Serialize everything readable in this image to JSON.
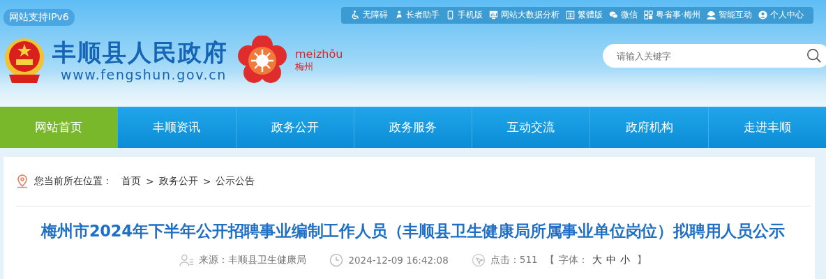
{
  "ipv6_badge": "网站支持IPv6",
  "toolbar": [
    {
      "kind": "wheelchair",
      "label": "无障碍"
    },
    {
      "kind": "elder",
      "label": "长者助手"
    },
    {
      "kind": "phone",
      "label": "手机版"
    },
    {
      "kind": "chart",
      "label": "网站大数据分析"
    },
    {
      "kind": "traditional",
      "label": "繁體版"
    },
    {
      "kind": "wechat",
      "label": "微信"
    },
    {
      "kind": "grid",
      "label": "粤省事·梅州"
    },
    {
      "kind": "service",
      "label": "智能互动"
    },
    {
      "kind": "user",
      "label": "个人中心"
    }
  ],
  "site": {
    "title": "丰顺县人民政府",
    "url": "www.fengshun.gov.cn",
    "city_logo": {
      "pinyin": "meizhōu",
      "name": "梅州"
    }
  },
  "search": {
    "placeholder": "请输入关键字"
  },
  "nav": [
    {
      "label": "网站首页",
      "selected": true
    },
    {
      "label": "丰顺资讯",
      "selected": false
    },
    {
      "label": "政务公开",
      "selected": false
    },
    {
      "label": "政务服务",
      "selected": false
    },
    {
      "label": "互动交流",
      "selected": false
    },
    {
      "label": "政府机构",
      "selected": false
    },
    {
      "label": "走进丰顺",
      "selected": false
    }
  ],
  "breadcrumb": {
    "label": "您当前所在位置：",
    "items": [
      "首页",
      "政务公开",
      "公示公告"
    ],
    "separator": ">"
  },
  "article": {
    "title": "梅州市2024年下半年公开招聘事业编制工作人员（丰顺县卫生健康局所属事业单位岗位）拟聘用人员公示",
    "source": "来源：丰顺县卫生健康局",
    "date": "2024-12-09 16:42:08",
    "clicks": "点击：511",
    "font": {
      "open": "【",
      "label": "字体：",
      "sizes": [
        "大",
        "中",
        "小"
      ],
      "close": "】"
    }
  }
}
